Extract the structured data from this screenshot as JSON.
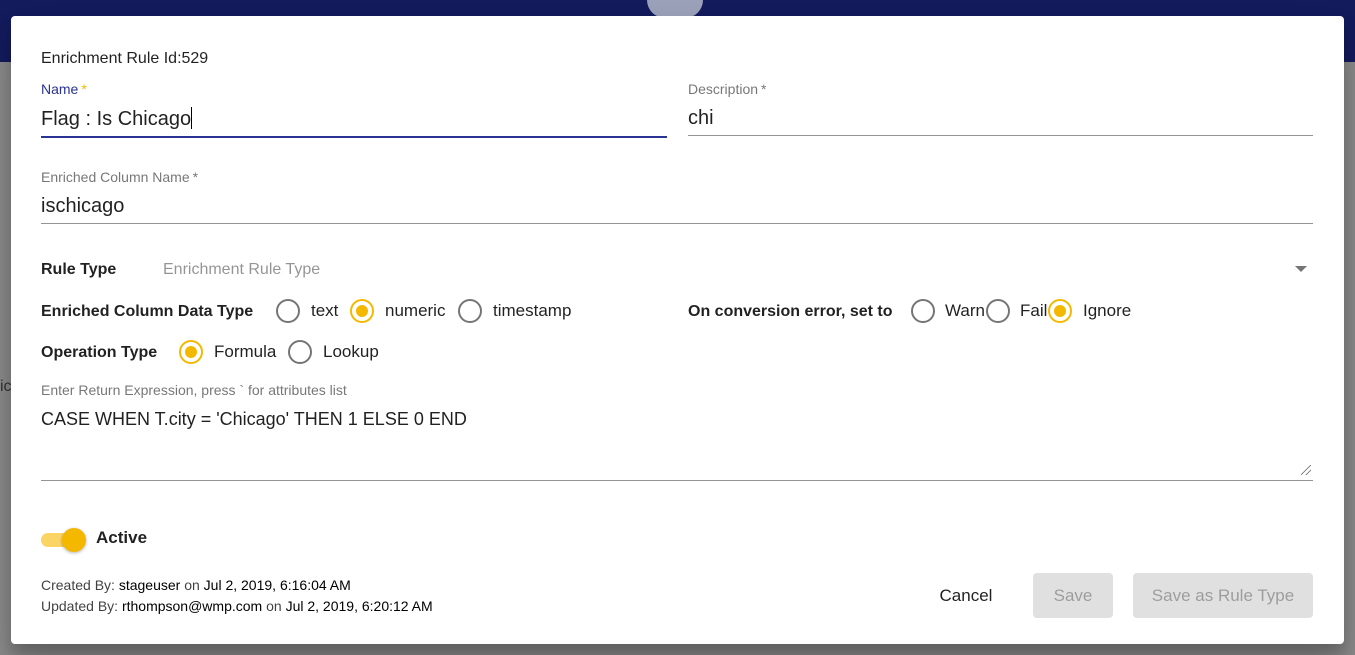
{
  "dialog": {
    "rule_id": "Enrichment Rule Id:529"
  },
  "name_field": {
    "label": "Name",
    "required": "*",
    "value": "Flag : Is Chicago"
  },
  "description_field": {
    "label": "Description",
    "required": "*",
    "value": "chi"
  },
  "column_field": {
    "label": "Enriched Column Name",
    "required": "*",
    "value": "ischicago"
  },
  "rule_type": {
    "label": "Rule Type",
    "placeholder": "Enrichment Rule Type"
  },
  "data_type": {
    "label": "Enriched Column Data Type",
    "options": [
      "text",
      "numeric",
      "timestamp"
    ],
    "selected": "numeric"
  },
  "conversion_error": {
    "label": "On conversion error, set to",
    "options": [
      "Warn",
      "Fail",
      "Ignore"
    ],
    "selected": "Ignore"
  },
  "operation_type": {
    "label": "Operation Type",
    "options": [
      "Formula",
      "Lookup"
    ],
    "selected": "Formula"
  },
  "expression": {
    "label": "Enter Return Expression, press ` for attributes list",
    "value": "CASE WHEN T.city = 'Chicago' THEN 1 ELSE 0 END"
  },
  "active_toggle": {
    "label": "Active",
    "on": true
  },
  "audit": {
    "created_prefix": "Created By:",
    "created_user": "stageuser",
    "on": "on",
    "created_date": "Jul 2, 2019, 6:16:04 AM",
    "updated_prefix": "Updated By:",
    "updated_user": "rthompson@wmp.com",
    "updated_date": "Jul 2, 2019, 6:20:12 AM"
  },
  "buttons": {
    "cancel": "Cancel",
    "save": "Save",
    "save_as_rule_type": "Save as Rule Type"
  },
  "background": {
    "text": "ic"
  },
  "colors": {
    "accent": "#f5b800",
    "focus": "#2a3293",
    "topbar": "#131b5c"
  }
}
